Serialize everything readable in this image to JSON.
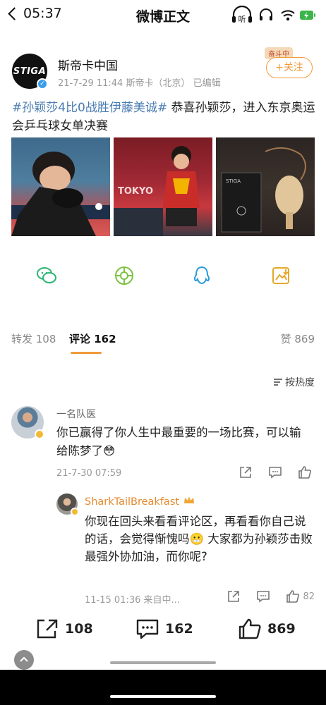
{
  "status": {
    "time": "05:37",
    "title": "微博正文",
    "listen_label": "听"
  },
  "author": {
    "logo_text": "STIGA",
    "name": "斯帝卡中国",
    "meta": "21-7-29 11:44  斯帝卡（北京）  已编辑",
    "follow_label": "+关注",
    "badge": "奋斗中"
  },
  "post": {
    "hashtag": "#孙颖莎4比0战胜伊藤美诚#",
    "text": " 恭喜孙颖莎，进入东京奥运会乒乓球女单决赛"
  },
  "tabs": {
    "repost": "转发 108",
    "comment": "评论 162",
    "like": "赞 869"
  },
  "sort_label": "按热度",
  "comment": {
    "author": "一名队医",
    "text": "你已赢得了你人生中最重要的一场比赛，可以输给陈梦了😳",
    "time": "21-7-30 07:59"
  },
  "reply": {
    "author": "SharkTailBreakfast",
    "text": "你现在回头来看看评论区，再看看你自己说的话，会觉得惭愧吗😬 大家都为孙颖莎击败最强外协加油，而你呢?",
    "meta": "11-15 01:36  来自中...",
    "like_count": "82"
  },
  "bottom": {
    "repost_count": "108",
    "comment_count": "162",
    "like_count": "869"
  },
  "colors": {
    "accent": "#f19a39",
    "hashtag": "#4a7cb1",
    "wechat": "#2bb673",
    "moments": "#7dc242",
    "qq": "#2a9ad8",
    "save": "#e5a829"
  }
}
